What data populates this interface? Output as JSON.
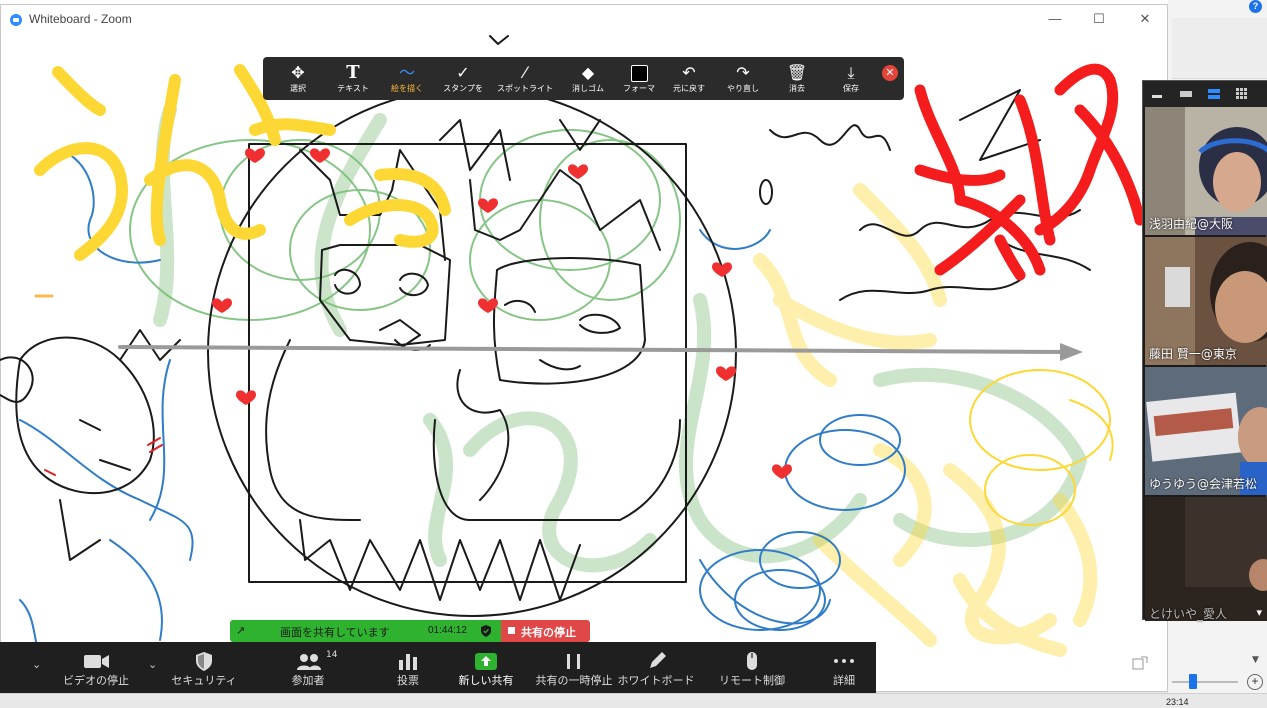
{
  "window": {
    "title": "Whiteboard - Zoom",
    "minimize": "—",
    "maximize": "☐",
    "close": "✕"
  },
  "whiteboard_toolbar": {
    "tools": [
      {
        "label": "選択",
        "icon": "move-icon"
      },
      {
        "label": "テキスト",
        "icon": "text-icon"
      },
      {
        "label": "絵を描く",
        "icon": "draw-icon",
        "active": true
      },
      {
        "label": "スタンプを",
        "icon": "check-stamp-icon"
      },
      {
        "label": "スポットライト",
        "icon": "spotlight-icon"
      },
      {
        "label": "消しゴム",
        "icon": "eraser-icon"
      },
      {
        "label": "フォーマ",
        "icon": "format-icon"
      },
      {
        "label": "元に戻す",
        "icon": "undo-icon"
      },
      {
        "label": "やり直し",
        "icon": "redo-icon"
      },
      {
        "label": "消去",
        "icon": "trash-icon"
      },
      {
        "label": "保存",
        "icon": "save-icon"
      }
    ],
    "close_icon": "close-icon"
  },
  "participants_video": [
    {
      "name": "浅羽由紀@大阪"
    },
    {
      "name": "藤田 賢一@東京"
    },
    {
      "name": "ゆうゆう@会津若松"
    },
    {
      "name": "とけいや_愛人"
    }
  ],
  "share_bar": {
    "status": "画面を共有しています",
    "elapsed": "01:44:12",
    "stop_label": "共有の停止"
  },
  "meeting_controls": {
    "items": [
      {
        "label": "ビデオの停止",
        "icon": "video-camera-icon"
      },
      {
        "label": "セキュリティ",
        "icon": "shield-icon"
      },
      {
        "label": "参加者",
        "icon": "participants-icon",
        "count": "14"
      },
      {
        "label": "投票",
        "icon": "poll-icon"
      },
      {
        "label": "新しい共有",
        "icon": "share-arrow-icon",
        "highlight": "#2fb22f"
      },
      {
        "label": "共有の一時停止",
        "icon": "pause-icon"
      },
      {
        "label": "ホワイトボード",
        "icon": "pen-icon"
      },
      {
        "label": "リモート制御",
        "icon": "mouse-icon"
      },
      {
        "label": "詳細",
        "icon": "more-icon"
      }
    ]
  },
  "taskbar": {
    "clock": "23:14"
  },
  "colors": {
    "zoom_blue": "#2d8cff",
    "share_green": "#2fb22f",
    "stop_red": "#e04848",
    "yellow_ink": "#fdd835",
    "red_ink": "#f41c1c",
    "green_ink": "#8bc48a",
    "blue_ink": "#2f7cc8",
    "heart_red": "#f03030"
  }
}
